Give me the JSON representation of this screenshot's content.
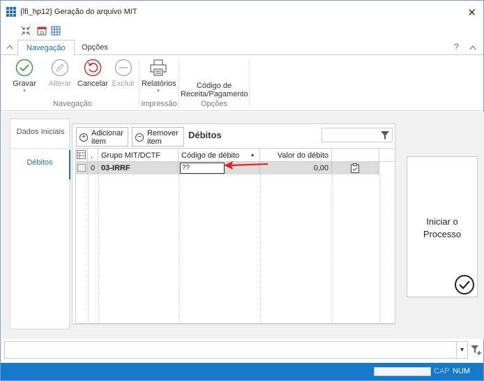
{
  "window": {
    "title": "{lfi_hp12}  Geração do arquivo MIT",
    "close_glyph": "✕"
  },
  "quick_toolbar": {
    "icons": [
      "compress-icon",
      "calendar-icon",
      "grid-icon"
    ]
  },
  "ribbon_tabs": [
    {
      "label": "Navegação",
      "active": true
    },
    {
      "label": "Opções",
      "active": false
    }
  ],
  "help_glyph": "?",
  "ribbon": {
    "gravar": "Gravar",
    "alterar": "Alterar",
    "cancelar": "Cancelar",
    "excluir": "Excluir",
    "relatorios": "Relatórios",
    "codigo_receita": "Código de Receita/Pagamento",
    "groups": {
      "navegacao": "Navegação",
      "impressao": "Impressão",
      "opcoes": "Opções"
    }
  },
  "sidenav": {
    "items": [
      {
        "label": "Dados Iniciais"
      },
      {
        "label": "Débitos"
      }
    ]
  },
  "panel": {
    "add_button": "Adicionar item",
    "remove_button": "Remover item",
    "title": "Débitos",
    "filter_value": ""
  },
  "grid": {
    "headers": {
      "dot": ".",
      "grupo": "Grupo MIT/DCTF",
      "codigo": "Código de débito",
      "valor": "Valor do débito",
      "sort_glyph": "▲"
    },
    "rows": [
      {
        "index": "0",
        "grupo": "03-IRRF",
        "codigo": "??",
        "valor": "0,00"
      }
    ]
  },
  "start_panel": {
    "label": "Iniciar o Processo"
  },
  "statusbar": {
    "cap": "CAP",
    "num": "NUM"
  },
  "colors": {
    "accent": "#1f6fb8",
    "status_bar": "#1479c9",
    "arrow": "#e8201c"
  }
}
